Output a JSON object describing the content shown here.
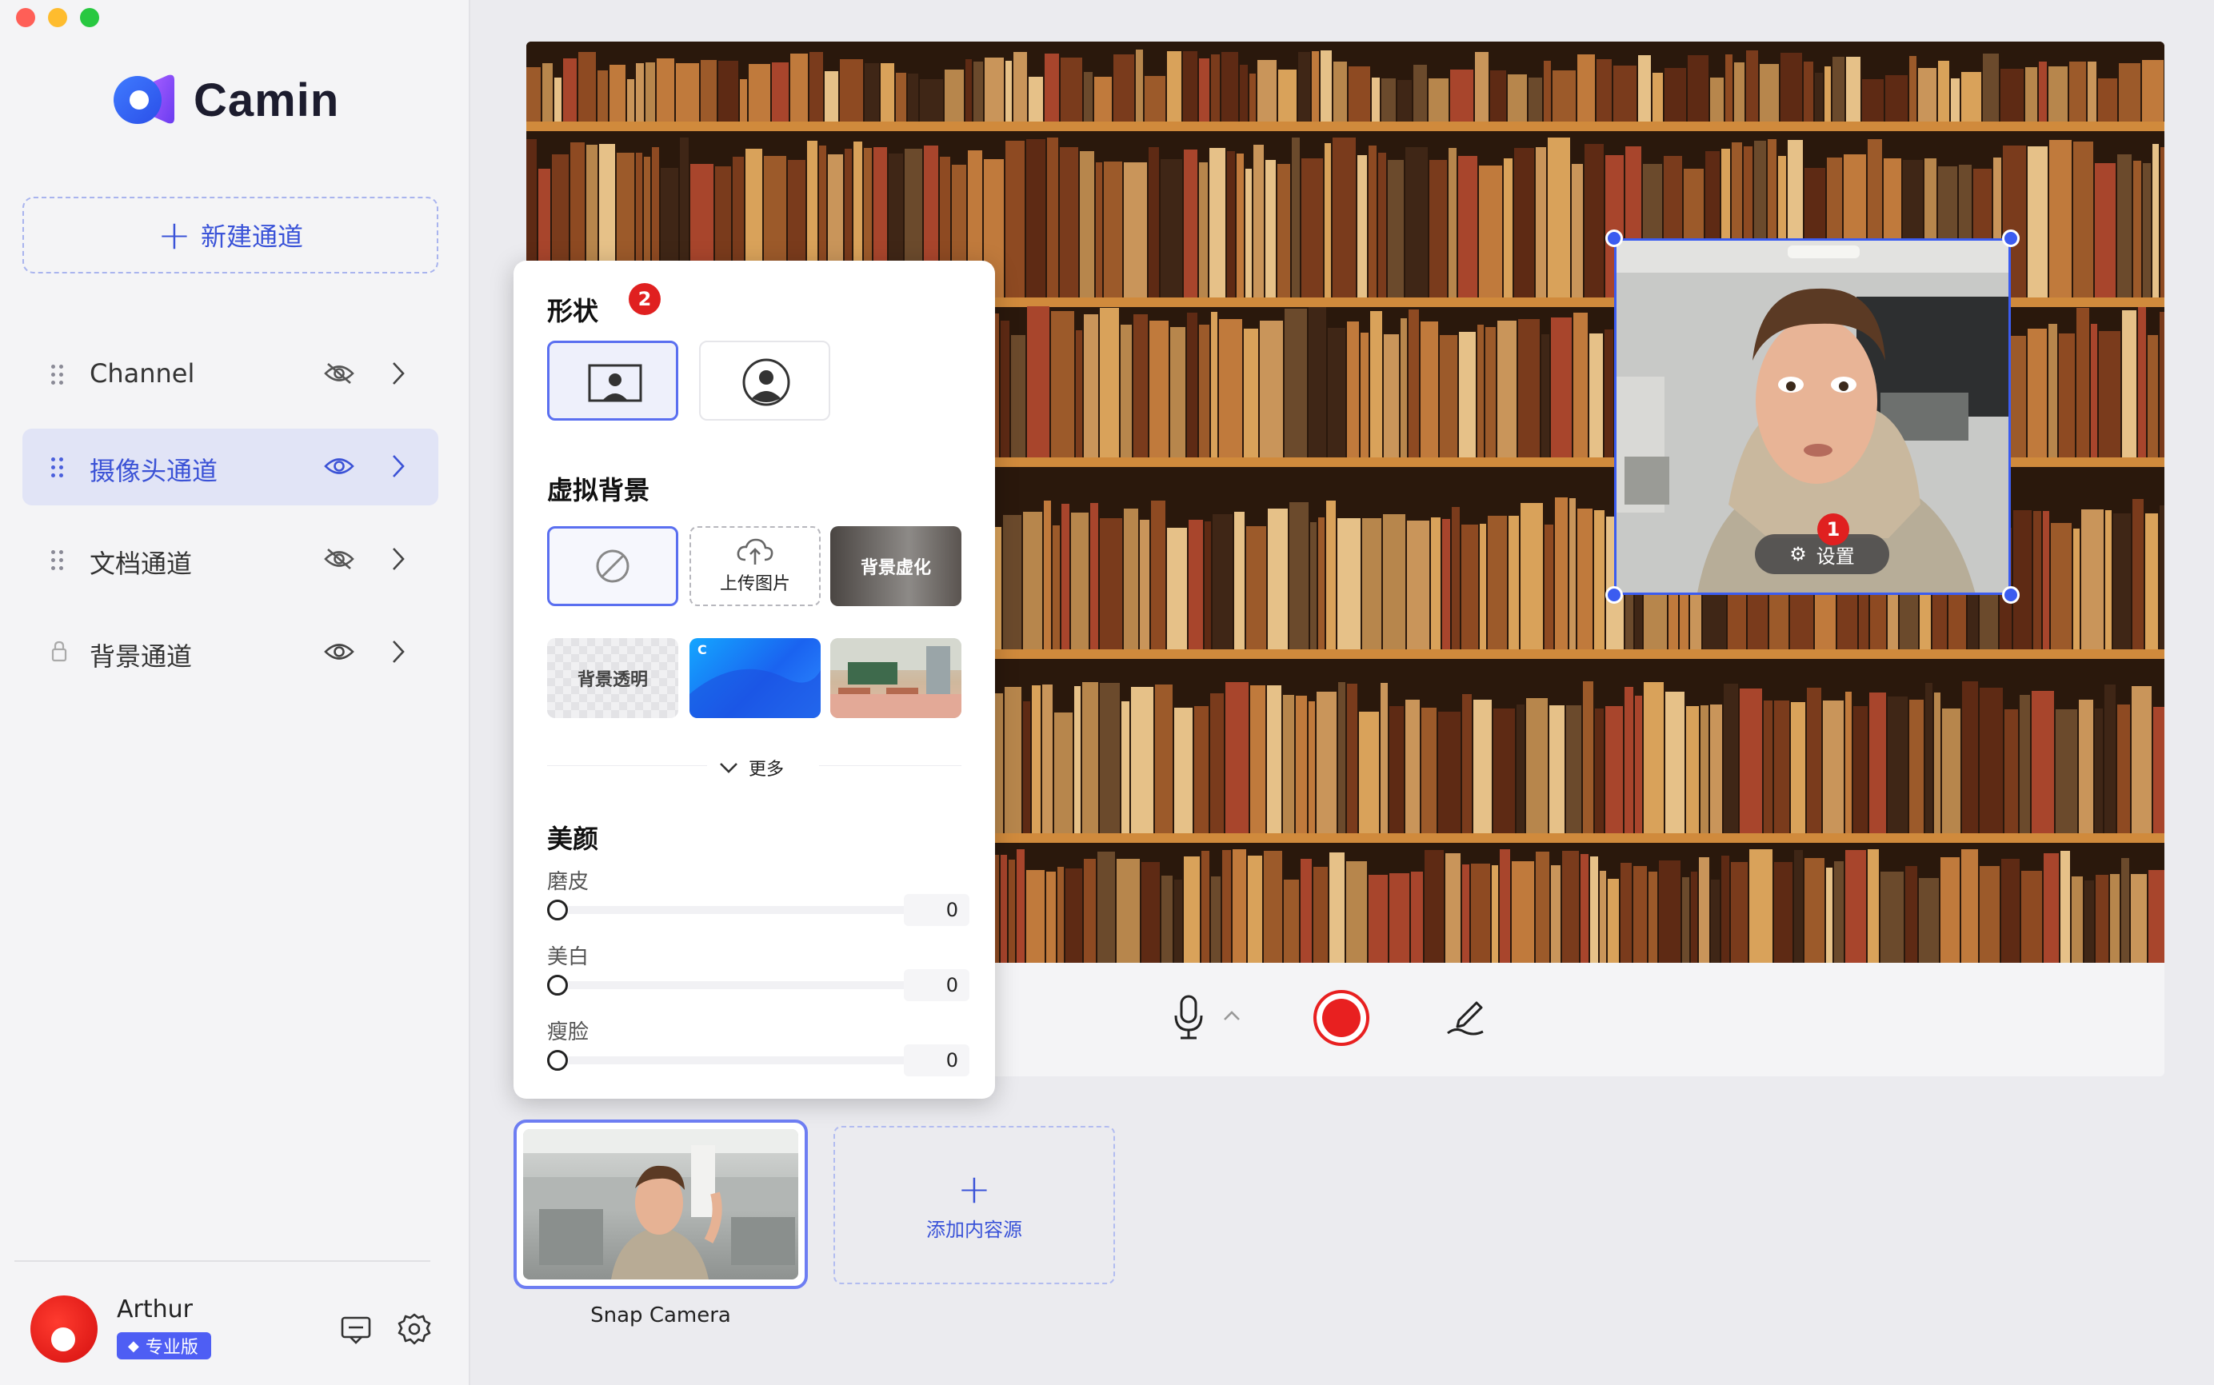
{
  "app": {
    "name": "Camin",
    "new_channel_label": "新建通道",
    "accent": "#3b52d6",
    "record_color": "#e82020"
  },
  "sidebar": {
    "channels": [
      {
        "label": "Channel",
        "visible": false,
        "locked": false,
        "active": false
      },
      {
        "label": "摄像头通道",
        "visible": true,
        "locked": false,
        "active": true
      },
      {
        "label": "文档通道",
        "visible": false,
        "locked": false,
        "active": false
      },
      {
        "label": "背景通道",
        "visible": true,
        "locked": true,
        "active": false
      }
    ],
    "user": {
      "name": "Arthur",
      "plan": "专业版"
    }
  },
  "stage": {
    "camera_settings_label": "设置",
    "badge_1": "1",
    "toolbar": {
      "icons": [
        "mic-icon",
        "caret-up-icon",
        "record-icon",
        "pen-icon"
      ]
    }
  },
  "panel": {
    "shape_title": "形状",
    "badge_2": "2",
    "shapes": [
      "rectangle-person-icon",
      "circle-person-icon"
    ],
    "vbg_title": "虚拟背景",
    "vbg_options": {
      "none_icon": "ban-icon",
      "upload": "上传图片",
      "blur": "背景虚化",
      "transparent": "背景透明"
    },
    "more": "更多",
    "beauty_title": "美颜",
    "beauty": [
      {
        "label": "磨皮",
        "value": "0"
      },
      {
        "label": "美白",
        "value": "0"
      },
      {
        "label": "瘦脸",
        "value": "0"
      }
    ]
  },
  "sources": {
    "items": [
      {
        "label": "Snap Camera"
      }
    ],
    "add_label": "添加内容源"
  }
}
